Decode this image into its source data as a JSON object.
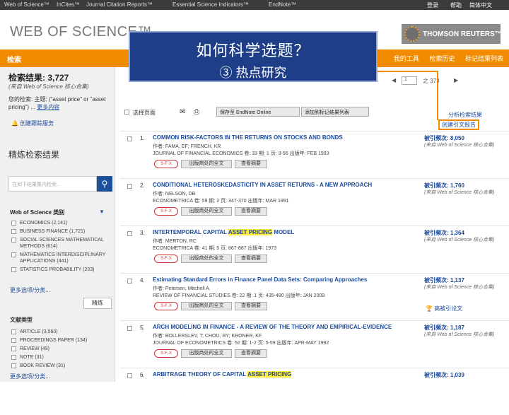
{
  "topbar": {
    "links": [
      "Web of Science™",
      "InCites™",
      "Journal Citation Reports™",
      "Essential Science Indicators™",
      "EndNote™"
    ],
    "right": [
      "登录",
      "帮助",
      "简体中文"
    ]
  },
  "header": {
    "logo": "WEB OF SCIENCE™",
    "brand": "THOMSON REUTERS™"
  },
  "orangebar": {
    "search": "检索",
    "items": [
      "我的工具",
      "检索历史",
      "标记结果列表"
    ]
  },
  "overlay": {
    "line1": "如何科学选题？",
    "line2": "③ 热点研究"
  },
  "sidebar": {
    "count": "检索结果: 3,727",
    "from": "(来自 Web of Science 核心合集)",
    "query_label": "您的检索: 主题: (\"asset price\" or \"asset pricing\") ...",
    "query_more": "更多内容",
    "alert": "创建跟踪服务",
    "refine": "精炼检索结果",
    "search_placeholder": "在如下结果集内检索...",
    "cat_head": "Web of Science 类别",
    "categories": [
      "ECONOMICS (2,141)",
      "BUSINESS FINANCE (1,721)",
      "SOCIAL SCIENCES MATHEMATICAL METHODS (614)",
      "MATHEMATICS INTERDISCIPLINARY APPLICATIONS (441)",
      "STATISTICS PROBABILITY (233)"
    ],
    "more": "更多选项/分类...",
    "refine_btn": "精炼",
    "doc_head": "文献类型",
    "doctypes": [
      "ARTICLE (3,560)",
      "PROCEEDINGS PAPER (134)",
      "REVIEW (49)",
      "NOTE (31)",
      "BOOK REVIEW (31)"
    ],
    "more2": "更多选项/分类..."
  },
  "pagination": {
    "page": "1",
    "of": "之 373"
  },
  "toolbar": {
    "select_all": "选择页面",
    "save_btn": "保存至 EndNote Online",
    "add_btn": "添加到标记结果列表",
    "analyze": "分析检索结果",
    "report": "创建引文报告"
  },
  "records": [
    {
      "num": "1.",
      "title": "COMMON RISK-FACTORS IN THE RETURNS ON STOCKS AND BONDS",
      "authors": "作者: FAMA, EF; FRENCH, KR",
      "source": "JOURNAL OF FINANCIAL ECONOMICS  卷: 33  期: 1  页: 3-56  出版年: FEB 1993",
      "cites": "被引频次: 8,050",
      "from": "(来自 Web of Science 核心合集)",
      "sfx": "S·F·X",
      "fulltext": "出版商处的全文",
      "abstract": "查看摘要",
      "hot": ""
    },
    {
      "num": "2.",
      "title": "CONDITIONAL HETEROSKEDASTICITY IN ASSET RETURNS - A NEW APPROACH",
      "authors": "作者: NELSON, DB",
      "source": "ECONOMETRICA  卷: 59  期: 2  页: 347-370  出版年: MAR 1991",
      "cites": "被引频次: 1,760",
      "from": "(来自 Web of Science 核心合集)",
      "sfx": "S·F·X",
      "fulltext": "出版商处的全文",
      "abstract": "查看摘要",
      "hot": ""
    },
    {
      "num": "3.",
      "title_a": "INTERTEMPORAL CAPITAL ",
      "title_hl": "ASSET PRICING",
      "title_b": " MODEL",
      "authors": "作者: MERTON, RC",
      "source": "ECONOMETRICA  卷: 41  期: 5  页: 867-887  出版年: 1973",
      "cites": "被引频次: 1,364",
      "from": "(来自 Web of Science 核心合集)",
      "sfx": "S·F·X",
      "fulltext": "出版商处的全文",
      "abstract": "查看摘要",
      "hot": ""
    },
    {
      "num": "4.",
      "title": "Estimating Standard Errors in Finance Panel Data Sets: Comparing Approaches",
      "authors": "作者: Petersen, Mitchell A.",
      "source": "REVIEW OF FINANCIAL STUDIES  卷: 22  期: 1  页: 435-480  出版年: JAN 2009",
      "cites": "被引频次: 1,137",
      "from": "(来自 Web of Science 核心合集)",
      "sfx": "S·F·X",
      "fulltext": "出版商处的全文",
      "abstract": "查看摘要",
      "hot": "高被引论文"
    },
    {
      "num": "5.",
      "title": "ARCH MODELING IN FINANCE - A REVIEW OF THE THEORY AND EMPIRICAL-EVIDENCE",
      "authors": "作者: BOLLERSLEV, T; CHOU, RY; KRONER, KF",
      "source": "JOURNAL OF ECONOMETRICS  卷: 52  期: 1-2  页: 5-59  出版年: APR-MAY 1992",
      "cites": "被引频次: 1,187",
      "from": "(来自 Web of Science 核心合集)",
      "sfx": "S·F·X",
      "fulltext": "出版商处的全文",
      "abstract": "查看摘要",
      "hot": ""
    },
    {
      "num": "6.",
      "title_a": "ARBITRAGE THEORY OF CAPITAL ",
      "title_hl": "ASSET PRICING",
      "title_b": "",
      "authors": "",
      "source": "",
      "cites": "被引频次: 1,039",
      "from": "",
      "sfx": "",
      "fulltext": "",
      "abstract": "",
      "hot": ""
    }
  ]
}
